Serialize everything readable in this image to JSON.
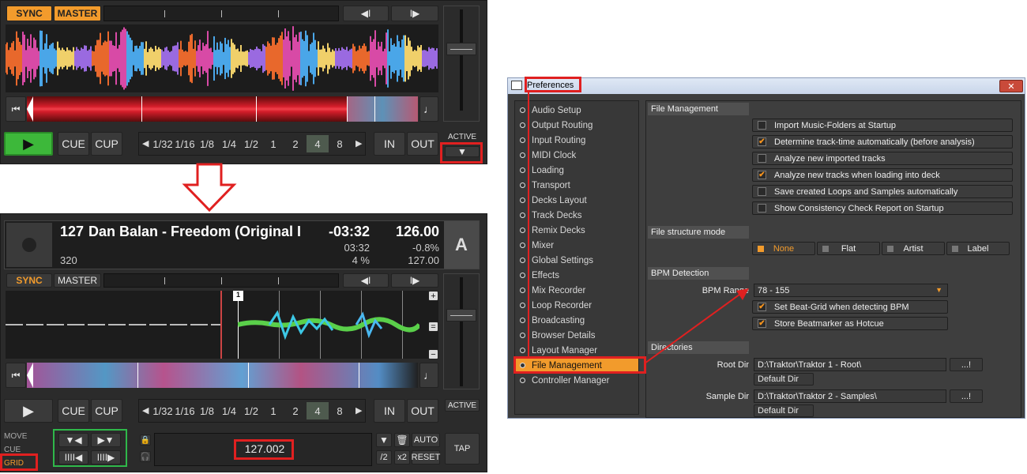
{
  "top_deck": {
    "sync_label": "SYNC",
    "master_label": "MASTER",
    "play_symbol": "▶",
    "cue_label": "CUE",
    "cup_label": "CUP",
    "loop_sizes": [
      "1/32",
      "1/16",
      "1/8",
      "1/4",
      "1/2",
      "1",
      "2",
      "4",
      "8"
    ],
    "loop_selected": "4",
    "in_label": "IN",
    "out_label": "OUT",
    "active_label": "ACTIVE"
  },
  "bottom_deck": {
    "track_number": "127",
    "track_title": "Dan Balan - Freedom (Original I",
    "remaining_time": "-03:32",
    "elapsed_time": "03:32",
    "bpm": "126.00",
    "pitch": "-0.8%",
    "tempo_percent": "4 %",
    "key_bpm": "127.00",
    "bitrate": "320",
    "deck_letter": "A",
    "sync_label": "SYNC",
    "master_label": "MASTER",
    "cue_label": "CUE",
    "cup_label": "CUP",
    "loop_sizes": [
      "1/32",
      "1/16",
      "1/8",
      "1/4",
      "1/2",
      "1",
      "2",
      "4",
      "8"
    ],
    "loop_selected": "4",
    "in_label": "IN",
    "out_label": "OUT",
    "active_label": "ACTIVE",
    "beat_marker": "1",
    "mode_move": "MOVE",
    "mode_cue": "CUE",
    "mode_grid": "GRID",
    "grid_bpm": "127.002",
    "auto_label": "AUTO",
    "reset_label": "RESET",
    "half_label": "/2",
    "double_label": "x2",
    "tap_label": "TAP"
  },
  "preferences": {
    "title": "Preferences",
    "close_symbol": "✕",
    "nav_items": [
      "Audio Setup",
      "Output Routing",
      "Input Routing",
      "MIDI Clock",
      "Loading",
      "Transport",
      "Decks Layout",
      "Track Decks",
      "Remix Decks",
      "Mixer",
      "Global Settings",
      "Effects",
      "Mix Recorder",
      "Loop Recorder",
      "Broadcasting",
      "Browser Details",
      "Layout Manager",
      "File Management",
      "Controller Manager"
    ],
    "selected_nav": "File Management",
    "file_management": {
      "header": "File Management",
      "options": [
        {
          "label": "Import Music-Folders at Startup",
          "checked": false
        },
        {
          "label": "Determine track-time automatically (before analysis)",
          "checked": true
        },
        {
          "label": "Analyze new imported tracks",
          "checked": false
        },
        {
          "label": "Analyze new tracks when loading into deck",
          "checked": true
        },
        {
          "label": "Save created Loops and Samples automatically",
          "checked": false
        },
        {
          "label": "Show Consistency Check Report on Startup",
          "checked": false
        }
      ]
    },
    "structure_mode": {
      "header": "File structure mode",
      "options": [
        "None",
        "Flat",
        "Artist",
        "Label"
      ],
      "selected": "None"
    },
    "bpm_detection": {
      "header": "BPM Detection",
      "range_label": "BPM Range",
      "range_value": "78 - 155",
      "options": [
        {
          "label": "Set Beat-Grid when detecting BPM",
          "checked": true
        },
        {
          "label": "Store Beatmarker as Hotcue",
          "checked": true
        }
      ]
    },
    "directories": {
      "header": "Directories",
      "root_label": "Root Dir",
      "root_value": "D:\\Traktor\\Traktor 1 - Root\\",
      "sample_label": "Sample Dir",
      "sample_value": "D:\\Traktor\\Traktor 2 - Samples\\",
      "browse_label": "...!",
      "default_label": "Default Dir"
    }
  },
  "colors": {
    "accent_orange": "#f29b2c",
    "annotation_red": "#e02020",
    "annotation_green": "#2fb84a"
  }
}
